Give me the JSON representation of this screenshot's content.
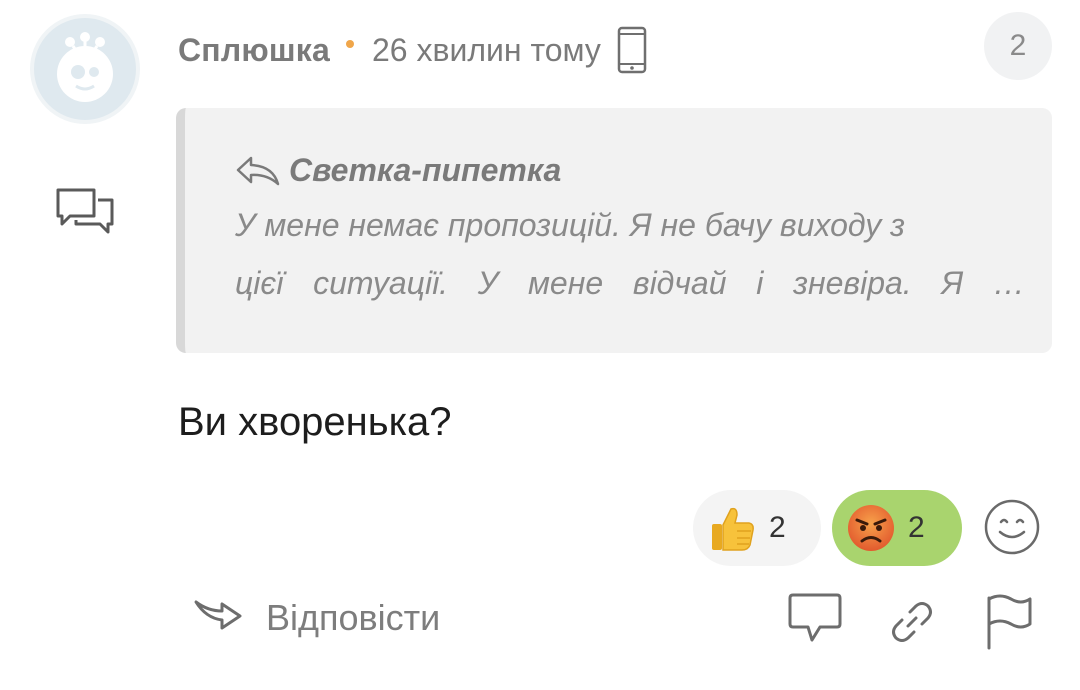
{
  "comment": {
    "author": "Сплюшка",
    "timestamp": "26 хвилин тому",
    "device_icon": "phone-icon",
    "reply_count": "2",
    "avatar_icon": "alien-avatar-icon"
  },
  "quote": {
    "author": "Светка-пипетка",
    "line1": "У мене немає пропозицій. Я не бачу виходу з",
    "line2_words": [
      "цієї",
      "ситуації.",
      "У",
      "мене",
      "відчай",
      "і",
      "зневіра.",
      "Я",
      "…"
    ]
  },
  "body": "Ви хворенька?",
  "reactions": [
    {
      "icon": "thumbs-up-icon",
      "count": "2"
    },
    {
      "icon": "angry-face-icon",
      "count": "2"
    }
  ],
  "actions": {
    "reply_label": "Відповісти"
  },
  "colors": {
    "accent_dot": "#f0a64a",
    "active_reaction": "#a9d46e",
    "muted_text": "#7a7a7a"
  }
}
